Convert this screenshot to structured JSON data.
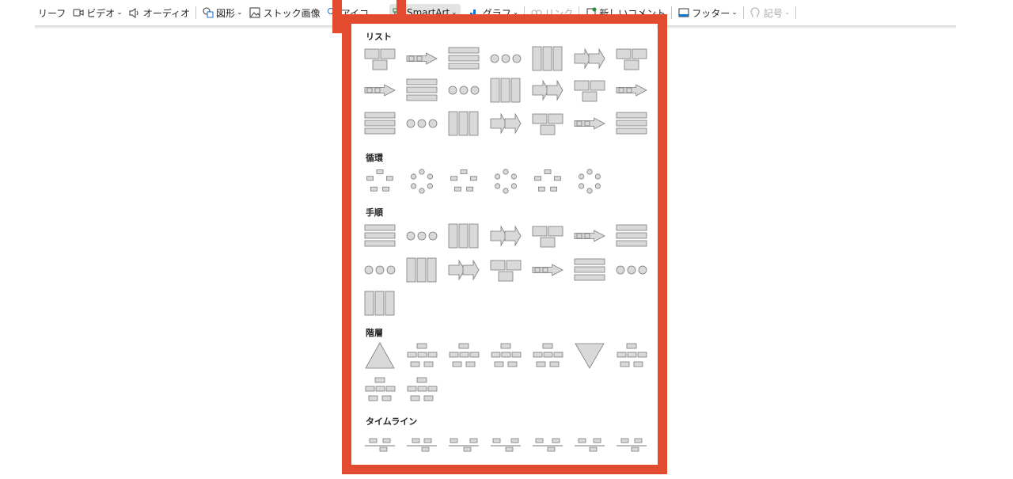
{
  "toolbar": {
    "items": [
      {
        "label": "リーフ",
        "icon": "none",
        "chevron": false
      },
      {
        "label": "ビデオ",
        "icon": "video-icon",
        "chevron": true
      },
      {
        "label": "オーディオ",
        "icon": "speaker-icon",
        "chevron": false
      },
      {
        "label": "図形",
        "icon": "shapes-icon",
        "chevron": true
      },
      {
        "label": "ストック画像",
        "icon": "stock-image-icon",
        "chevron": false
      },
      {
        "label": "アイコ",
        "icon": "icons-icon",
        "chevron": false
      },
      {
        "label": "SmartArt",
        "icon": "smartart-icon",
        "chevron": true
      },
      {
        "label": "グラフ",
        "icon": "chart-icon",
        "chevron": true
      },
      {
        "label": "リンク",
        "icon": "link-icon",
        "chevron": false
      },
      {
        "label": "新しいコメント",
        "icon": "comment-icon",
        "chevron": false
      },
      {
        "label": "フッター",
        "icon": "footer-icon",
        "chevron": true
      },
      {
        "label": "記号",
        "icon": "symbol-icon",
        "chevron": true
      }
    ]
  },
  "gallery": {
    "sections": [
      {
        "title": "リスト",
        "count": 21
      },
      {
        "title": "循環",
        "count": 6
      },
      {
        "title": "手順",
        "count": 15
      },
      {
        "title": "階層",
        "count": 9
      },
      {
        "title": "タイムライン",
        "count": 7
      }
    ]
  },
  "colors": {
    "highlight": "#e34b31",
    "shape_fill": "#d9d9d9",
    "shape_stroke": "#7a7a7a"
  }
}
